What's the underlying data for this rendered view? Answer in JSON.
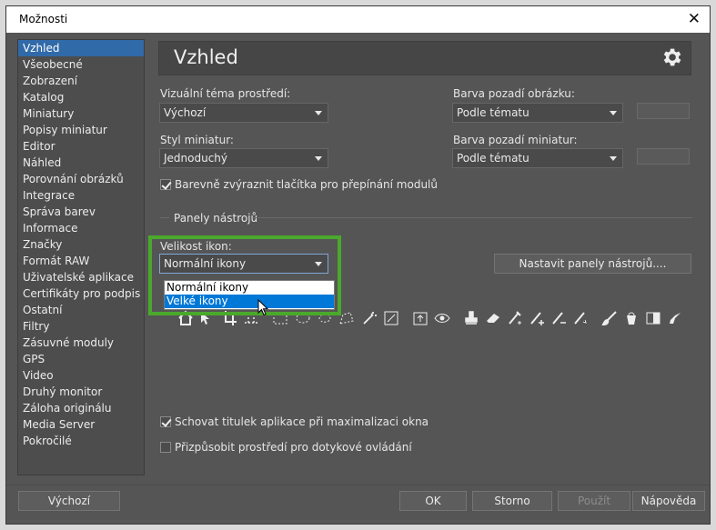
{
  "window": {
    "title": "Možnosti",
    "close_glyph": "✕"
  },
  "sidebar": {
    "items": [
      {
        "label": "Vzhled",
        "selected": true
      },
      {
        "label": "Všeobecné"
      },
      {
        "label": "Zobrazení"
      },
      {
        "label": "Katalog"
      },
      {
        "label": "Miniatury"
      },
      {
        "label": "Popisy miniatur"
      },
      {
        "label": "Editor"
      },
      {
        "label": "Náhled"
      },
      {
        "label": "Porovnání obrázků"
      },
      {
        "label": "Integrace"
      },
      {
        "label": "Správa barev"
      },
      {
        "label": "Informace"
      },
      {
        "label": "Značky"
      },
      {
        "label": "Formát RAW"
      },
      {
        "label": "Uživatelské aplikace"
      },
      {
        "label": "Certifikáty pro podpis"
      },
      {
        "label": "Ostatní"
      },
      {
        "label": "Filtry"
      },
      {
        "label": "Zásuvné moduly"
      },
      {
        "label": "GPS"
      },
      {
        "label": "Video"
      },
      {
        "label": "Druhý monitor"
      },
      {
        "label": "Záloha originálu"
      },
      {
        "label": "Media Server"
      },
      {
        "label": "Pokročilé"
      }
    ]
  },
  "header": {
    "title": "Vzhled",
    "icon": "gear-icon"
  },
  "appearance": {
    "theme_label": "Vizuální téma prostředí:",
    "theme_value": "Výchozí",
    "bg_label": "Barva pozadí obrázku:",
    "bg_value": "Podle tématu",
    "thumb_style_label": "Styl miniatur:",
    "thumb_style_value": "Jednoduchý",
    "thumb_bg_label": "Barva pozadí miniatur:",
    "thumb_bg_value": "Podle tématu",
    "highlight_label": "Barevně zvýraznit tlačítka pro přepínání modulů",
    "highlight_checked": true
  },
  "toolbars": {
    "group_label": "Panely nástrojů",
    "icon_size_label": "Velikost ikon:",
    "icon_size_value": "Normální ikony",
    "icon_size_options": [
      "Normální ikony",
      "Velké ikony"
    ],
    "icon_size_hovered": "Velké ikony",
    "configure_button": "Nastavit panely nástrojů...."
  },
  "options": {
    "hide_title_label": "Schovat titulek aplikace při maximalizaci okna",
    "hide_title_checked": true,
    "touch_label": "Přizpůsobit prostředí pro dotykové ovládání",
    "touch_checked": false
  },
  "buttons": {
    "defaults": "Výchozí",
    "ok": "OK",
    "cancel": "Storno",
    "apply": "Použít",
    "help": "Nápověda"
  },
  "colors": {
    "accent_selection": "#316aa9",
    "callout_border": "#4aa82c",
    "dropdown_selected": "#0078d7"
  }
}
